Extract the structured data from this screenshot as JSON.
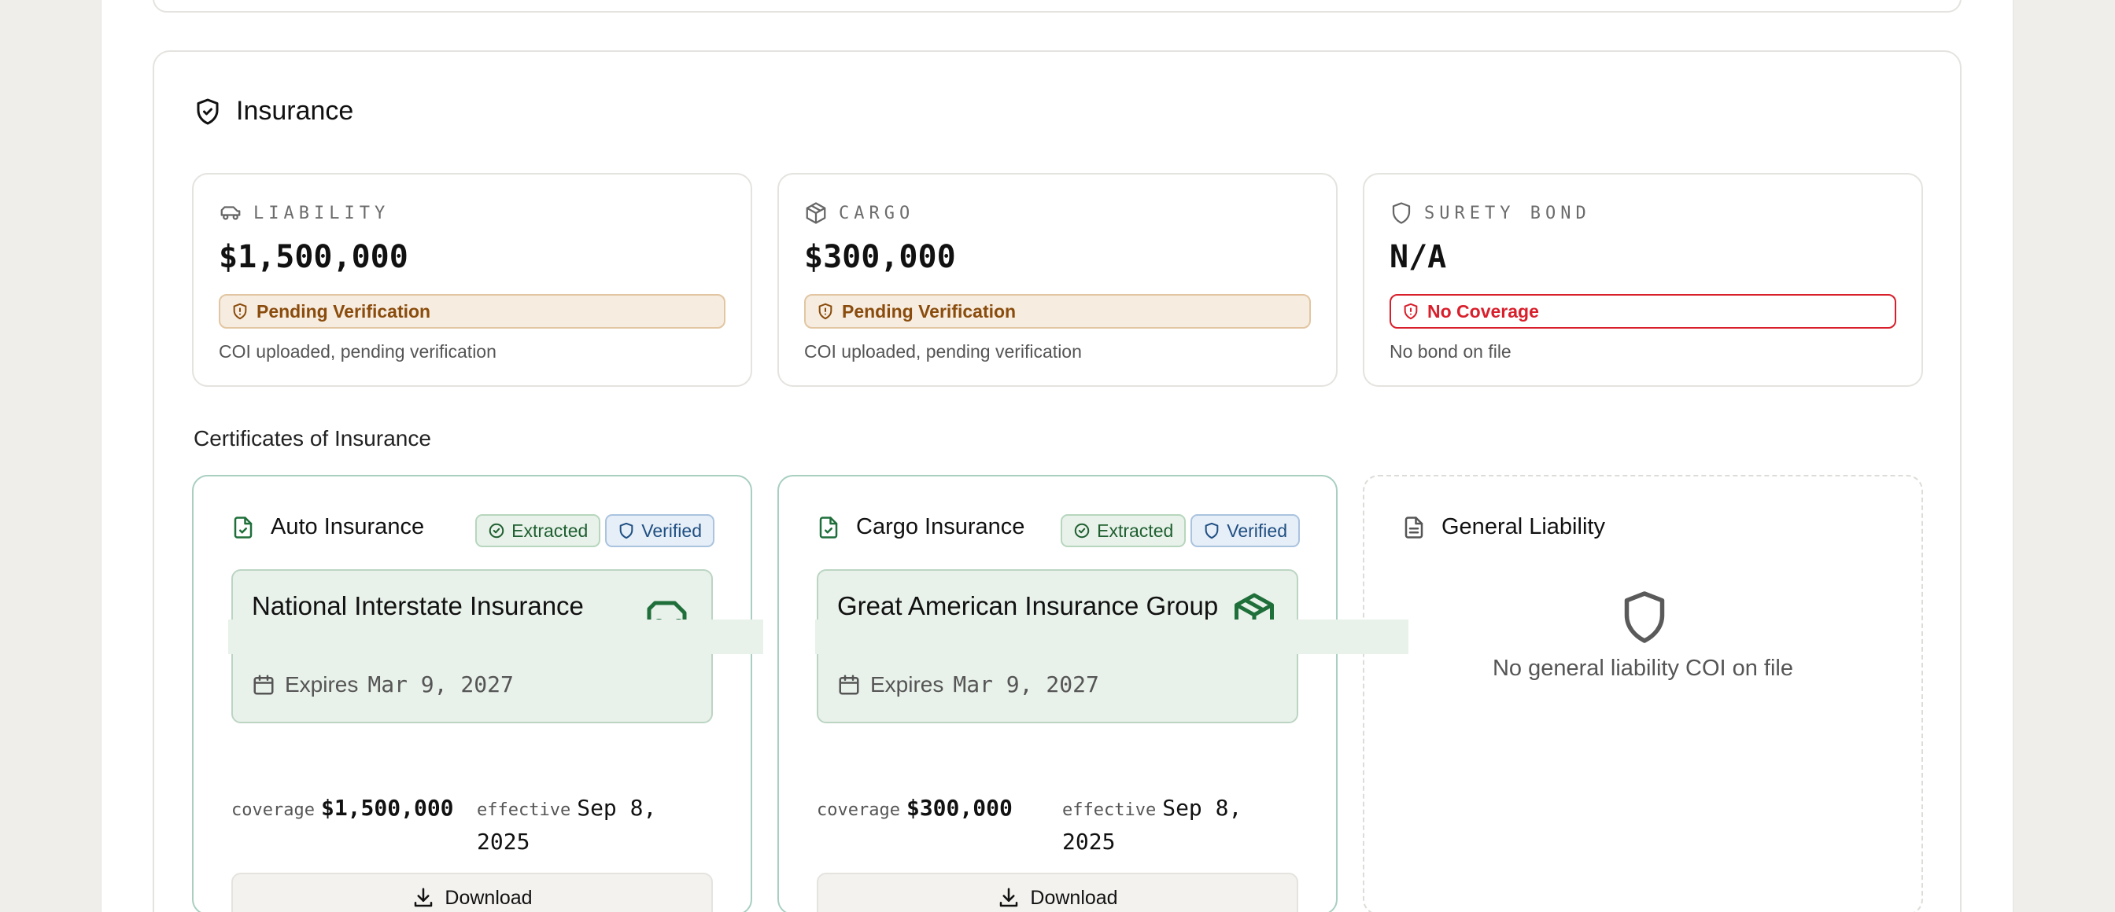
{
  "section": {
    "title": "Insurance"
  },
  "summary": [
    {
      "label": "LIABILITY",
      "amount": "$1,500,000",
      "status": "Pending Verification",
      "note": "COI uploaded, pending verification",
      "icon": "truck-icon"
    },
    {
      "label": "CARGO",
      "amount": "$300,000",
      "status": "Pending Verification",
      "note": "COI uploaded, pending verification",
      "icon": "box-icon"
    },
    {
      "label": "SURETY BOND",
      "amount": "N/A",
      "status": "No Coverage",
      "note": "No bond on file",
      "icon": "shield-icon"
    }
  ],
  "coi": {
    "heading": "Certificates of Insurance",
    "cards": [
      {
        "title": "Auto Insurance",
        "extracted": "Extracted",
        "verified": "Verified",
        "carrier": "National Interstate Insurance",
        "expires_label": "Expires",
        "expires_date": "Mar 9, 2027",
        "coverage_label": "coverage",
        "coverage": "$1,500,000",
        "effective_label": "effective",
        "effective": "Sep 8, 2025",
        "download": "Download"
      },
      {
        "title": "Cargo Insurance",
        "extracted": "Extracted",
        "verified": "Verified",
        "carrier": "Great American Insurance Group",
        "expires_label": "Expires",
        "expires_date": "Mar 9, 2027",
        "coverage_label": "coverage",
        "coverage": "$300,000",
        "effective_label": "effective",
        "effective": "Sep 8, 2025",
        "download": "Download"
      }
    ],
    "empty": {
      "title": "General Liability",
      "message": "No general liability COI on file"
    }
  },
  "colors": {
    "accent_green": "#1f6f3a",
    "pending": "#8a4c0c",
    "danger": "#d81f2b",
    "verified_blue": "#1f4f82"
  }
}
